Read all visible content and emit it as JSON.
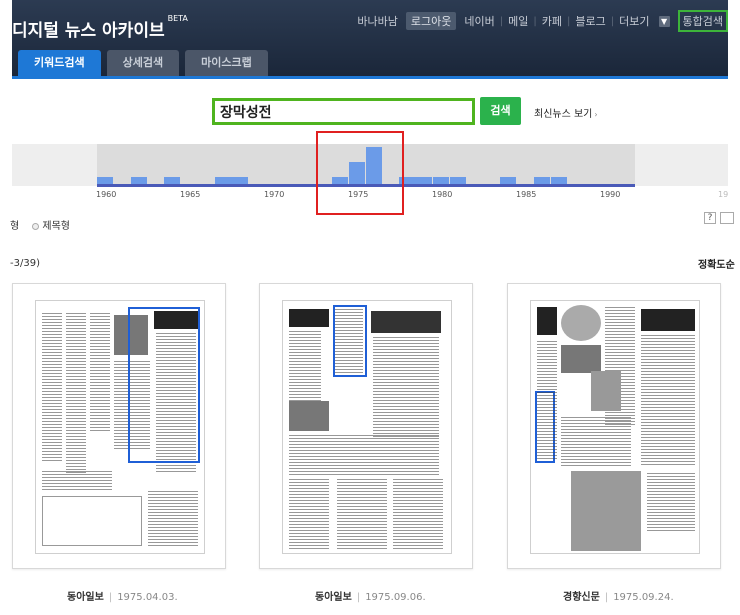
{
  "header": {
    "logo": "디지털 뉴스 아카이브",
    "beta": "BETA",
    "nav": [
      "바나바남",
      "로그아웃",
      "네이버",
      "메일",
      "카페",
      "블로그",
      "더보기"
    ],
    "integrated_search": "통합검색"
  },
  "tabs": [
    "키워드검색",
    "상세검색",
    "마이스크랩"
  ],
  "search": {
    "value": "장막성전",
    "button": "검색",
    "recent_link": "최신뉴스 보기"
  },
  "timeline": {
    "years": [
      "1960",
      "1965",
      "1970",
      "1975",
      "1980",
      "1985",
      "1990"
    ],
    "partial_year": "19"
  },
  "chart_data": {
    "type": "bar",
    "categories": [
      "1960",
      "1961",
      "1962",
      "1963",
      "1964",
      "1965",
      "1966",
      "1967",
      "1968",
      "1969",
      "1970",
      "1971",
      "1972",
      "1973",
      "1974",
      "1975",
      "1976",
      "1977",
      "1978",
      "1979",
      "1980",
      "1981",
      "1982",
      "1983",
      "1984",
      "1985",
      "1986",
      "1987",
      "1988",
      "1989",
      "1990",
      "1991"
    ],
    "values": [
      1,
      0,
      1,
      0,
      1,
      0,
      0,
      1,
      1,
      0,
      0,
      0,
      0,
      0,
      1,
      3,
      5,
      0,
      1,
      1,
      1,
      1,
      0,
      0,
      1,
      0,
      1,
      1,
      0,
      0,
      0,
      0
    ],
    "xlabel": "",
    "ylabel": ""
  },
  "view_options": {
    "type1": "형",
    "type2": "제목형"
  },
  "results": {
    "count": "-3/39)",
    "sort": "정확도순"
  },
  "cards": [
    {
      "paper": "동아일보",
      "date": "1975.04.03."
    },
    {
      "paper": "동아일보",
      "date": "1975.09.06."
    },
    {
      "paper": "경향신문",
      "date": "1975.09.24."
    }
  ],
  "help": {
    "q": "?"
  }
}
